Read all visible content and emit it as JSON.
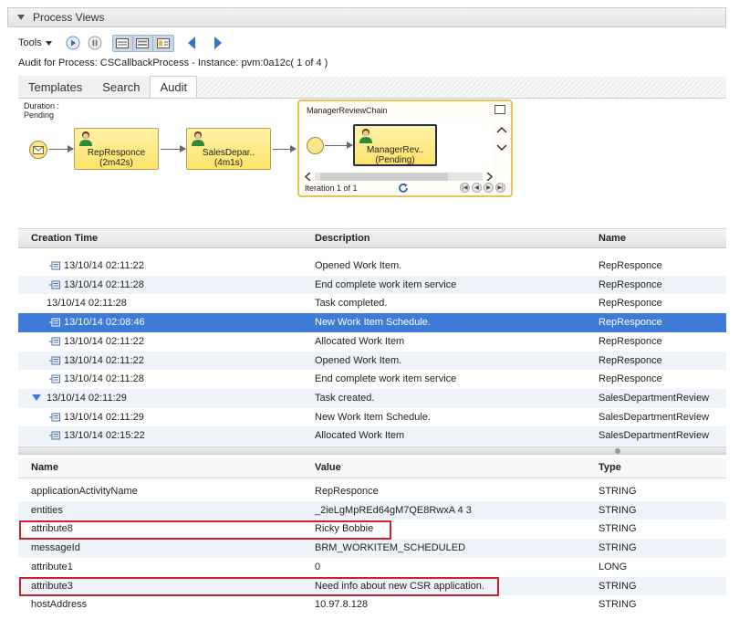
{
  "panel": {
    "title": "Process Views"
  },
  "toolbar": {
    "tools_label": "Tools"
  },
  "audit_caption": "Audit for Process: CSCallbackProcess - Instance: pvm:0a12c( 1 of 4 )",
  "tabs": [
    {
      "label": "Templates",
      "active": false
    },
    {
      "label": "Search",
      "active": false
    },
    {
      "label": "Audit",
      "active": true
    }
  ],
  "diagram": {
    "duration_label": "Duration :",
    "duration_value": "Pending",
    "tasks": [
      {
        "name": "RepResponce",
        "detail": "(2m42s)"
      },
      {
        "name": "SalesDepar..",
        "detail": "(4m1s)"
      }
    ],
    "subprocess": {
      "title": "ManagerReviewChain",
      "task_name": "ManagerRev..",
      "task_detail": "(Pending)",
      "iteration": "Iteration 1 of 1"
    }
  },
  "audit_grid": {
    "headers": {
      "time": "Creation Time",
      "description": "Description",
      "name": "Name"
    },
    "rows": [
      {
        "time": "13/10/14 02:11:22",
        "description": "Opened Work Item.",
        "name": "RepResponce",
        "icon": "workitem-icon",
        "indent": 1,
        "selected": false
      },
      {
        "time": "13/10/14 02:11:28",
        "description": "End complete work item service",
        "name": "RepResponce",
        "icon": "workitem-icon",
        "indent": 1,
        "selected": false
      },
      {
        "time": "13/10/14 02:11:28",
        "description": "Task completed.",
        "name": "RepResponce",
        "icon": "",
        "indent": 0,
        "selected": false
      },
      {
        "time": "13/10/14 02:08:46",
        "description": "New Work Item Schedule.",
        "name": "RepResponce",
        "icon": "workitem-icon",
        "indent": 1,
        "selected": true
      },
      {
        "time": "13/10/14 02:11:22",
        "description": "Allocated Work Item",
        "name": "RepResponce",
        "icon": "workitem-icon",
        "indent": 1,
        "selected": false
      },
      {
        "time": "13/10/14 02:11:22",
        "description": "Opened Work Item.",
        "name": "RepResponce",
        "icon": "workitem-icon",
        "indent": 1,
        "selected": false
      },
      {
        "time": "13/10/14 02:11:28",
        "description": "End complete work item service",
        "name": "RepResponce",
        "icon": "workitem-icon",
        "indent": 1,
        "selected": false
      },
      {
        "time": "13/10/14 02:11:29",
        "description": "Task created.",
        "name": "SalesDepartmentReview",
        "icon": "expand-icon",
        "indent": 0,
        "selected": false
      },
      {
        "time": "13/10/14 02:11:29",
        "description": "New Work Item Schedule.",
        "name": "SalesDepartmentReview",
        "icon": "workitem-icon",
        "indent": 1,
        "selected": false
      },
      {
        "time": "13/10/14 02:15:22",
        "description": "Allocated Work Item",
        "name": "SalesDepartmentReview",
        "icon": "workitem-icon",
        "indent": 1,
        "selected": false
      }
    ]
  },
  "attributes_grid": {
    "headers": {
      "name": "Name",
      "value": "Value",
      "type": "Type"
    },
    "rows": [
      {
        "name": "applicationActivityName",
        "value": "RepResponce",
        "type": "STRING"
      },
      {
        "name": "entities",
        "value": "_2ieLgMpREd64gM7QE8RwxA 4 3",
        "type": "STRING"
      },
      {
        "name": "attribute8",
        "value": "Ricky Bobbie",
        "type": "STRING"
      },
      {
        "name": "messageId",
        "value": "BRM_WORKITEM_SCHEDULED",
        "type": "STRING"
      },
      {
        "name": "attribute1",
        "value": "0",
        "type": "LONG"
      },
      {
        "name": "attribute3",
        "value": "Need info about new CSR application.",
        "type": "STRING"
      },
      {
        "name": "hostAddress",
        "value": "10.97.8.128",
        "type": "STRING"
      }
    ]
  },
  "colors": {
    "selection": "#3e7bd6",
    "highlight_border": "#d0202a",
    "task_fill": "#fde36a"
  }
}
